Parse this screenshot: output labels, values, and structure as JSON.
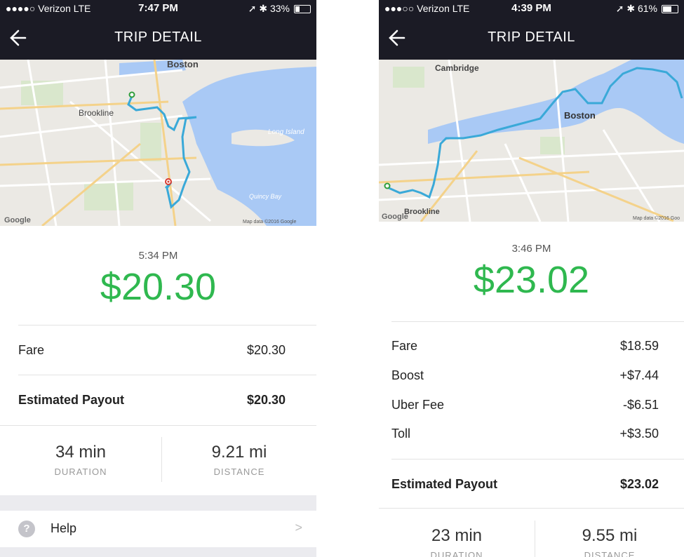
{
  "left_screen": {
    "status": {
      "carrier": "●●●●○ Verizon  LTE",
      "time": "7:47 PM",
      "indicators": "➚ ✱ 33%",
      "battery_level": 0.33
    },
    "nav": {
      "title": "TRIP DETAIL",
      "back_icon": "back-arrow-icon"
    },
    "map": {
      "labels": [
        "Boston",
        "Brookline",
        "Long Island",
        "Quincy Bay"
      ],
      "attribution": "Map data ©2016 Google",
      "logo": "Google"
    },
    "trip_time": "5:34 PM",
    "total": "$20.30",
    "line_items": [
      {
        "label": "Fare",
        "value": "$20.30"
      }
    ],
    "payout": {
      "label": "Estimated Payout",
      "value": "$20.30"
    },
    "stats": {
      "duration_value": "34 min",
      "duration_label": "DURATION",
      "distance_value": "9.21 mi",
      "distance_label": "DISTANCE"
    },
    "help": {
      "label": "Help",
      "icon": "help-question-icon",
      "chevron": ">"
    }
  },
  "right_screen": {
    "status": {
      "carrier": "●●●○○ Verizon  LTE",
      "time": "4:39 PM",
      "indicators": "➚ ✱ 61%",
      "battery_level": 0.61
    },
    "nav": {
      "title": "TRIP DETAIL",
      "back_icon": "back-arrow-icon"
    },
    "map": {
      "labels": [
        "Cambridge",
        "Boston",
        "Brookline"
      ],
      "attribution": "Map data ©2016 Goo",
      "logo": "Google"
    },
    "trip_time": "3:46 PM",
    "total": "$23.02",
    "line_items": [
      {
        "label": "Fare",
        "value": "$18.59"
      },
      {
        "label": "Boost",
        "value": "+$7.44"
      },
      {
        "label": "Uber Fee",
        "value": "-$6.51"
      },
      {
        "label": "Toll",
        "value": "+$3.50"
      }
    ],
    "payout": {
      "label": "Estimated Payout",
      "value": "$23.02"
    },
    "stats": {
      "duration_value": "23 min",
      "duration_label": "DURATION",
      "distance_value": "9.55 mi",
      "distance_label": "DISTANCE"
    }
  },
  "colors": {
    "header": "#1b1b25",
    "amount_green": "#2fb84f",
    "route": "#3aa9d8",
    "water": "#a9c9f5",
    "land": "#ebe9e4"
  }
}
